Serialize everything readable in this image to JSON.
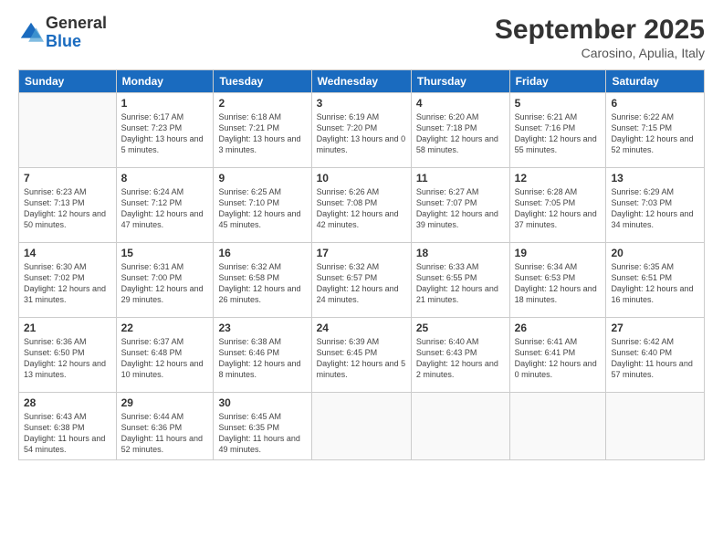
{
  "logo": {
    "general": "General",
    "blue": "Blue"
  },
  "header": {
    "month": "September 2025",
    "location": "Carosino, Apulia, Italy"
  },
  "days_of_week": [
    "Sunday",
    "Monday",
    "Tuesday",
    "Wednesday",
    "Thursday",
    "Friday",
    "Saturday"
  ],
  "weeks": [
    [
      {
        "day": "",
        "info": ""
      },
      {
        "day": "1",
        "info": "Sunrise: 6:17 AM\nSunset: 7:23 PM\nDaylight: 13 hours\nand 5 minutes."
      },
      {
        "day": "2",
        "info": "Sunrise: 6:18 AM\nSunset: 7:21 PM\nDaylight: 13 hours\nand 3 minutes."
      },
      {
        "day": "3",
        "info": "Sunrise: 6:19 AM\nSunset: 7:20 PM\nDaylight: 13 hours\nand 0 minutes."
      },
      {
        "day": "4",
        "info": "Sunrise: 6:20 AM\nSunset: 7:18 PM\nDaylight: 12 hours\nand 58 minutes."
      },
      {
        "day": "5",
        "info": "Sunrise: 6:21 AM\nSunset: 7:16 PM\nDaylight: 12 hours\nand 55 minutes."
      },
      {
        "day": "6",
        "info": "Sunrise: 6:22 AM\nSunset: 7:15 PM\nDaylight: 12 hours\nand 52 minutes."
      }
    ],
    [
      {
        "day": "7",
        "info": "Sunrise: 6:23 AM\nSunset: 7:13 PM\nDaylight: 12 hours\nand 50 minutes."
      },
      {
        "day": "8",
        "info": "Sunrise: 6:24 AM\nSunset: 7:12 PM\nDaylight: 12 hours\nand 47 minutes."
      },
      {
        "day": "9",
        "info": "Sunrise: 6:25 AM\nSunset: 7:10 PM\nDaylight: 12 hours\nand 45 minutes."
      },
      {
        "day": "10",
        "info": "Sunrise: 6:26 AM\nSunset: 7:08 PM\nDaylight: 12 hours\nand 42 minutes."
      },
      {
        "day": "11",
        "info": "Sunrise: 6:27 AM\nSunset: 7:07 PM\nDaylight: 12 hours\nand 39 minutes."
      },
      {
        "day": "12",
        "info": "Sunrise: 6:28 AM\nSunset: 7:05 PM\nDaylight: 12 hours\nand 37 minutes."
      },
      {
        "day": "13",
        "info": "Sunrise: 6:29 AM\nSunset: 7:03 PM\nDaylight: 12 hours\nand 34 minutes."
      }
    ],
    [
      {
        "day": "14",
        "info": "Sunrise: 6:30 AM\nSunset: 7:02 PM\nDaylight: 12 hours\nand 31 minutes."
      },
      {
        "day": "15",
        "info": "Sunrise: 6:31 AM\nSunset: 7:00 PM\nDaylight: 12 hours\nand 29 minutes."
      },
      {
        "day": "16",
        "info": "Sunrise: 6:32 AM\nSunset: 6:58 PM\nDaylight: 12 hours\nand 26 minutes."
      },
      {
        "day": "17",
        "info": "Sunrise: 6:32 AM\nSunset: 6:57 PM\nDaylight: 12 hours\nand 24 minutes."
      },
      {
        "day": "18",
        "info": "Sunrise: 6:33 AM\nSunset: 6:55 PM\nDaylight: 12 hours\nand 21 minutes."
      },
      {
        "day": "19",
        "info": "Sunrise: 6:34 AM\nSunset: 6:53 PM\nDaylight: 12 hours\nand 18 minutes."
      },
      {
        "day": "20",
        "info": "Sunrise: 6:35 AM\nSunset: 6:51 PM\nDaylight: 12 hours\nand 16 minutes."
      }
    ],
    [
      {
        "day": "21",
        "info": "Sunrise: 6:36 AM\nSunset: 6:50 PM\nDaylight: 12 hours\nand 13 minutes."
      },
      {
        "day": "22",
        "info": "Sunrise: 6:37 AM\nSunset: 6:48 PM\nDaylight: 12 hours\nand 10 minutes."
      },
      {
        "day": "23",
        "info": "Sunrise: 6:38 AM\nSunset: 6:46 PM\nDaylight: 12 hours\nand 8 minutes."
      },
      {
        "day": "24",
        "info": "Sunrise: 6:39 AM\nSunset: 6:45 PM\nDaylight: 12 hours\nand 5 minutes."
      },
      {
        "day": "25",
        "info": "Sunrise: 6:40 AM\nSunset: 6:43 PM\nDaylight: 12 hours\nand 2 minutes."
      },
      {
        "day": "26",
        "info": "Sunrise: 6:41 AM\nSunset: 6:41 PM\nDaylight: 12 hours\nand 0 minutes."
      },
      {
        "day": "27",
        "info": "Sunrise: 6:42 AM\nSunset: 6:40 PM\nDaylight: 11 hours\nand 57 minutes."
      }
    ],
    [
      {
        "day": "28",
        "info": "Sunrise: 6:43 AM\nSunset: 6:38 PM\nDaylight: 11 hours\nand 54 minutes."
      },
      {
        "day": "29",
        "info": "Sunrise: 6:44 AM\nSunset: 6:36 PM\nDaylight: 11 hours\nand 52 minutes."
      },
      {
        "day": "30",
        "info": "Sunrise: 6:45 AM\nSunset: 6:35 PM\nDaylight: 11 hours\nand 49 minutes."
      },
      {
        "day": "",
        "info": ""
      },
      {
        "day": "",
        "info": ""
      },
      {
        "day": "",
        "info": ""
      },
      {
        "day": "",
        "info": ""
      }
    ]
  ]
}
